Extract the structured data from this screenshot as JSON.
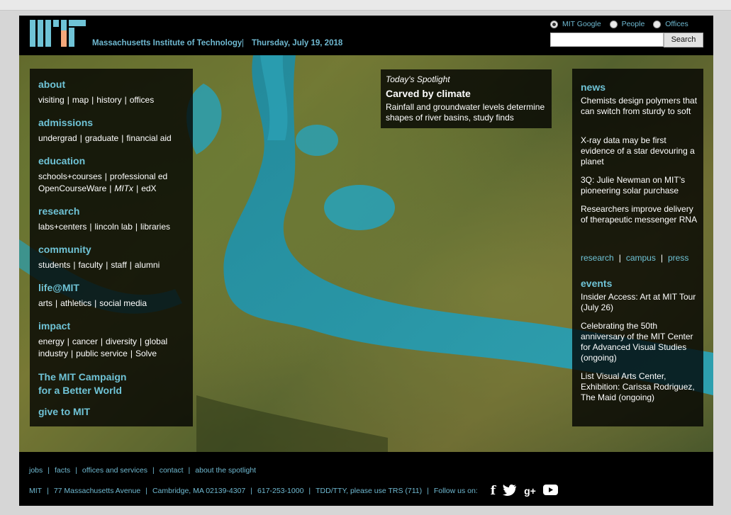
{
  "header": {
    "institute": "Massachusetts Institute of Technology",
    "separator": "|",
    "date": "Thursday, July 19, 2018",
    "search_options": [
      "MIT Google",
      "People",
      "Offices"
    ],
    "search_selected": "MIT Google",
    "search_button": "Search"
  },
  "left_nav": [
    {
      "title": "about",
      "lines": [
        [
          "visiting",
          "map",
          "history",
          "offices"
        ]
      ]
    },
    {
      "title": "admissions",
      "lines": [
        [
          "undergrad",
          "graduate",
          "financial aid"
        ]
      ]
    },
    {
      "title": "education",
      "lines": [
        [
          "schools+courses",
          "professional ed"
        ],
        [
          "OpenCourseWare",
          "MITx",
          "edX"
        ]
      ]
    },
    {
      "title": "research",
      "lines": [
        [
          "labs+centers",
          "lincoln lab",
          "libraries"
        ]
      ]
    },
    {
      "title": "community",
      "lines": [
        [
          "students",
          "faculty",
          "staff",
          "alumni"
        ]
      ]
    },
    {
      "title": "life@MIT",
      "lines": [
        [
          "arts",
          "athletics",
          "social media"
        ]
      ]
    },
    {
      "title": "impact",
      "lines": [
        [
          "energy",
          "cancer",
          "diversity",
          "global"
        ],
        [
          "industry",
          "public service",
          "Solve"
        ]
      ]
    }
  ],
  "campaign": {
    "line1": "The MIT Campaign",
    "line2": "for a Better World"
  },
  "give": "give to MIT",
  "spotlight": {
    "label": "Today's Spotlight",
    "title": "Carved by climate",
    "description": "Rainfall and groundwater levels determine shapes of river basins, study finds"
  },
  "news": {
    "title": "news",
    "items": [
      "Chemists design polymers that can switch from sturdy to soft",
      "X-ray data may be first evidence of a star devouring a planet",
      "3Q: Julie Newman on MIT’s pioneering solar purchase",
      "Researchers improve delivery of therapeutic messenger RNA"
    ],
    "links": [
      "research",
      "campus",
      "press"
    ]
  },
  "events": {
    "title": "events",
    "items": [
      "Insider Access: Art at MIT Tour (July 26)",
      "Celebrating the 50th anniversary of the MIT Center for Advanced Visual Studies (ongoing)",
      "List Visual Arts Center, Exhibition: Carissa Rodriguez, The Maid (ongoing)"
    ]
  },
  "footer": {
    "links": [
      "jobs",
      "facts",
      "offices and services",
      "contact",
      "about the spotlight"
    ],
    "info": [
      "MIT",
      "77 Massachusetts Avenue",
      "Cambridge, MA 02139-4307",
      "617-253-1000",
      "TDD/TTY, please use TRS (711)"
    ],
    "follow": "Follow us on:",
    "social": [
      "facebook-icon",
      "twitter-icon",
      "google-plus-icon",
      "youtube-icon"
    ]
  },
  "colors": {
    "accent": "#6fc3d6",
    "logo_teal": "#6fc3d6",
    "logo_orange": "#f4a97b"
  }
}
